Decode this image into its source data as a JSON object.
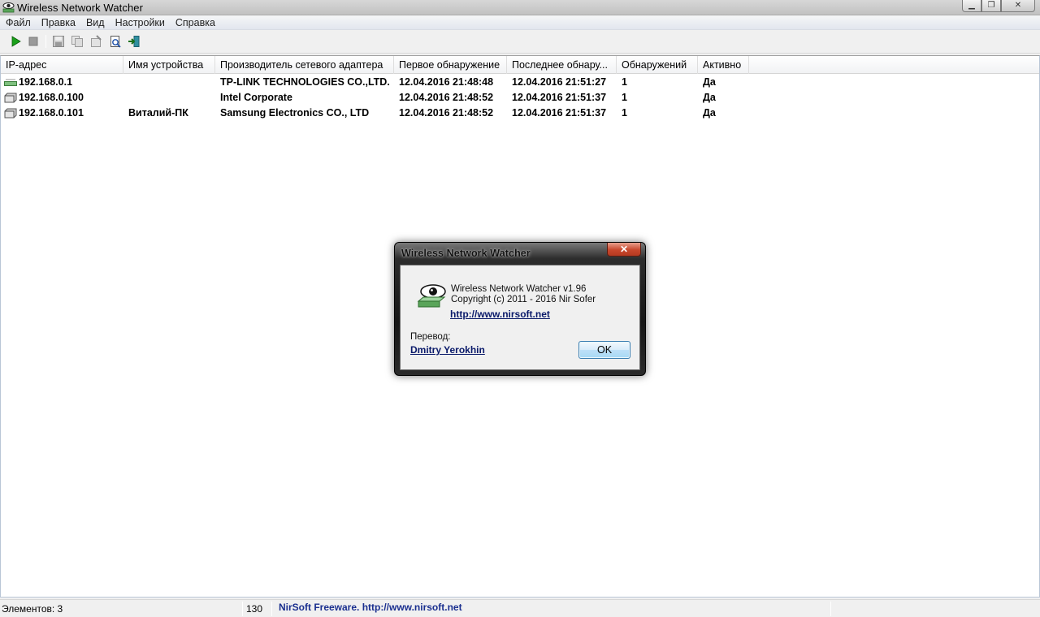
{
  "window": {
    "title": "Wireless Network Watcher",
    "controls": {
      "minimize": "▁",
      "maximize": "❐",
      "close": "✕"
    }
  },
  "menu": [
    "Файл",
    "Правка",
    "Вид",
    "Настройки",
    "Справка"
  ],
  "toolbar": {
    "buttons": [
      "start-icon",
      "stop-icon",
      "save-icon",
      "copy-icon",
      "properties-icon",
      "html-report-icon",
      "exit-icon"
    ]
  },
  "table": {
    "columns": [
      "IP-адрес",
      "Имя устройства",
      "Производитель сетевого адаптера",
      "Первое обнаружение",
      "Последнее обнару...",
      "Обнаружений",
      "Активно"
    ],
    "rows": [
      {
        "ip": "192.168.0.1",
        "device": "",
        "vendor": "TP-LINK TECHNOLOGIES CO.,LTD.",
        "first": "12.04.2016 21:48:48",
        "last": "12.04.2016 21:51:27",
        "count": "1",
        "active": "Да",
        "icon": "router-icon"
      },
      {
        "ip": "192.168.0.100",
        "device": "",
        "vendor": "Intel Corporate",
        "first": "12.04.2016 21:48:52",
        "last": "12.04.2016 21:51:37",
        "count": "1",
        "active": "Да",
        "icon": "computer-icon"
      },
      {
        "ip": "192.168.0.101",
        "device": "Виталий-ПК",
        "vendor": "Samsung Electronics CO., LTD",
        "first": "12.04.2016 21:48:52",
        "last": "12.04.2016 21:51:37",
        "count": "1",
        "active": "Да",
        "icon": "computer-icon"
      }
    ]
  },
  "statusbar": {
    "items": "Элементов: 3",
    "number": "130",
    "freeware": "NirSoft Freeware.  http://www.nirsoft.net"
  },
  "about_dialog": {
    "title": "Wireless Network Watcher",
    "close": "✕",
    "line1": "Wireless Network Watcher v1.96",
    "line2": "Copyright (c) 2011 - 2016 Nir Sofer",
    "link": "http://www.nirsoft.net",
    "translation_label": "Перевод:",
    "translator": "Dmitry Yerokhin",
    "ok": "OK"
  },
  "colors": {
    "link": "#0a1a6a",
    "freeware_text": "#1a2f8f",
    "list_bg": "#ffffff"
  }
}
